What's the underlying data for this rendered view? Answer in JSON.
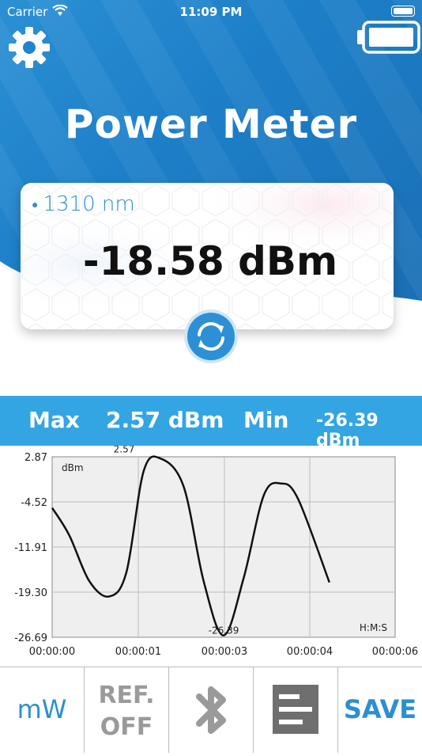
{
  "status_bar": {
    "carrier": "Carrier",
    "time": "11:09 PM"
  },
  "header": {
    "title": "Power Meter",
    "settings_icon": "gear-icon",
    "battery_icon": "battery-icon"
  },
  "reading": {
    "wavelength": "1310 nm",
    "value": "-18.58 dBm"
  },
  "stats": {
    "max_label": "Max",
    "max_value": "2.57 dBm",
    "min_label": "Min",
    "min_value": "-26.39 dBm"
  },
  "colors": {
    "primary": "#1d7fc8",
    "accent": "#33a5e3",
    "text_blue": "#2b8fd2",
    "disabled": "#9a9a9a"
  },
  "chart_data": {
    "type": "line",
    "y_unit_label": "dBm",
    "x_unit_label": "H:M:S",
    "ylim": [
      -26.69,
      2.87
    ],
    "y_ticks": [
      "2.87",
      "-4.52",
      "-11.91",
      "-19.30",
      "-26.69"
    ],
    "x_ticks": [
      "00:00:00",
      "00:00:01",
      "00:00:03",
      "00:00:04",
      "00:00:06"
    ],
    "grid": true,
    "annotations": [
      {
        "text": "2.57",
        "x": 1.3,
        "y": 2.57
      },
      {
        "text": "-26.39",
        "x": 3.0,
        "y": -26.39
      }
    ],
    "series": [
      {
        "x": [
          0.0,
          0.3,
          0.65,
          1.0,
          1.3,
          1.6,
          1.9,
          2.3,
          2.65,
          3.0,
          3.35,
          3.7,
          4.0,
          4.3,
          4.85
        ],
        "y": [
          -5.5,
          -10.0,
          -17.5,
          -20.0,
          -16.0,
          0.5,
          2.57,
          -2.0,
          -17.5,
          -26.39,
          -17.0,
          -3.5,
          -1.5,
          -4.0,
          -17.7
        ]
      }
    ]
  },
  "buttons": [
    {
      "label": "mW"
    },
    {
      "label_line1": "REF.",
      "label_line2": "OFF"
    },
    {
      "icon": "bluetooth-icon"
    },
    {
      "icon": "log-icon"
    },
    {
      "label": "SAVE"
    }
  ]
}
